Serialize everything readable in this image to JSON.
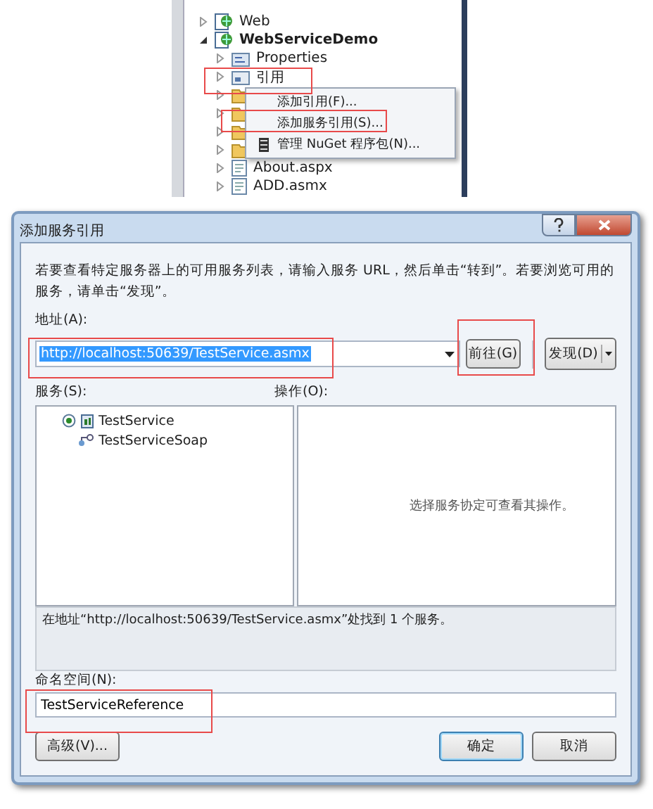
{
  "solution_explorer": {
    "items": [
      {
        "label": "Web",
        "kind": "project",
        "expanded": false
      },
      {
        "label": "WebServiceDemo",
        "kind": "project",
        "expanded": true,
        "children": [
          {
            "label": "Properties",
            "kind": "properties"
          },
          {
            "label": "引用",
            "kind": "references"
          },
          {
            "kind": "folder"
          },
          {
            "kind": "folder"
          },
          {
            "kind": "folder"
          },
          {
            "kind": "folder"
          },
          {
            "label": "About.aspx",
            "kind": "page"
          },
          {
            "label": "ADD.asmx",
            "kind": "page"
          }
        ]
      }
    ]
  },
  "context_menu": {
    "items": [
      {
        "label": "添加引用(F)...",
        "kind": "plain"
      },
      {
        "label": "添加服务引用(S)...",
        "kind": "plain"
      },
      {
        "label": "管理 NuGet 程序包(N)...",
        "kind": "nuget"
      }
    ]
  },
  "dialog": {
    "title": "添加服务引用",
    "description": "若要查看特定服务器上的可用服务列表，请输入服务 URL，然后单击“转到”。若要浏览可用的服务，请单击“发现”。",
    "address": {
      "label": "地址(A):",
      "value": "http://localhost:50639/TestService.asmx",
      "selected": true
    },
    "go_button": "前往(G)",
    "discover_button": "发现(D)",
    "services": {
      "label": "服务(S):",
      "items": [
        {
          "label": "TestService",
          "expanded": true,
          "children": [
            {
              "label": "TestServiceSoap"
            }
          ]
        }
      ]
    },
    "operations": {
      "label": "操作(O):",
      "message": "选择服务协定可查看其操作。"
    },
    "status": "在地址“http://localhost:50639/TestService.asmx”处找到 1 个服务。",
    "namespace": {
      "label": "命名空间(N):",
      "value": "TestServiceReference"
    },
    "advanced_button": "高级(V)...",
    "buttons": [
      {
        "label": "确定",
        "default": true
      },
      {
        "label": "取消",
        "default": false
      }
    ]
  }
}
